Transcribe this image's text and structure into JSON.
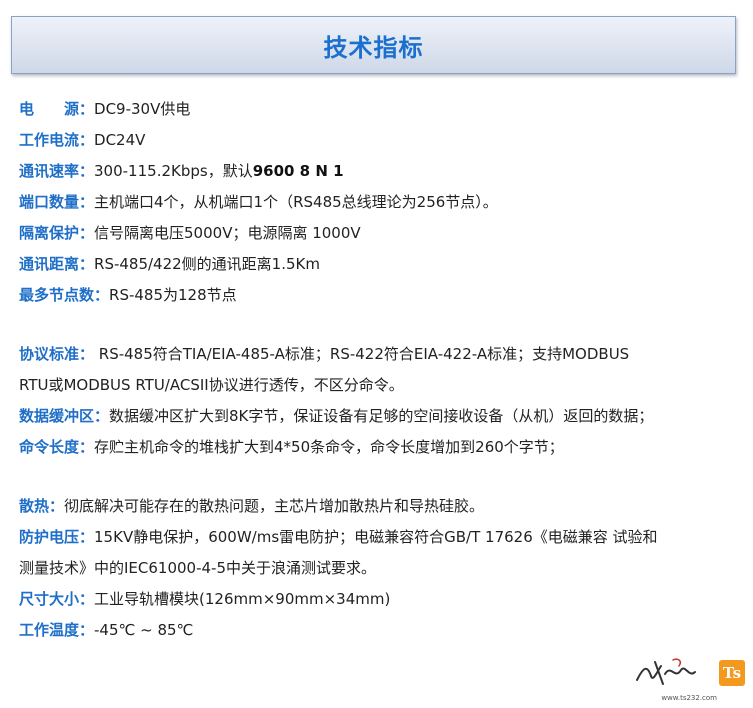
{
  "title": "技术指标",
  "specs": [
    {
      "label": "电　　源：",
      "value": "DC9-30V供电"
    },
    {
      "label": "工作电流：",
      "value": "DC24V"
    },
    {
      "label": "通讯速率：",
      "value": "300-115.2Kbps，默认",
      "strong": "9600 8 N 1"
    },
    {
      "label": "端口数量：",
      "value": "主机端口4个，从机端口1个（RS485总线理论为256节点）。"
    },
    {
      "label": "隔离保护：",
      "value": "信号隔离电压5000V；电源隔离  1000V"
    },
    {
      "label": "通讯距离：",
      "value": "RS-485/422侧的通讯距离1.5Km"
    },
    {
      "label": "最多节点数：",
      "value": "RS-485为128节点"
    },
    {
      "label": "协议标准：",
      "value": " RS-485符合TIA/EIA-485-A标准；RS-422符合EIA-422-A标准；支持MODBUS",
      "cont": "RTU或MODBUS RTU/ACSII协议进行透传，不区分命令。"
    },
    {
      "label": "数据缓冲区：",
      "value": "数据缓冲区扩大到8K字节，保证设备有足够的空间接收设备（从机）返回的数据；"
    },
    {
      "label": "命令长度：",
      "value": "存贮主机命令的堆栈扩大到4*50条命令，命令长度增加到260个字节；"
    },
    {
      "label": "散热：",
      "value": "彻底解决可能存在的散热问题，主芯片增加散热片和导热硅胶。"
    },
    {
      "label": "防护电压：",
      "value": "15KV静电保护，600W/ms雷电防护；电磁兼容符合GB/T 17626《电磁兼容 试验和",
      "cont": "测量技术》中的IEC61000-4-5中关于浪涌测试要求。"
    },
    {
      "label": "尺寸大小：",
      "value": "工业导轨槽模块(126mm×90mm×34mm)"
    },
    {
      "label": "工作温度：",
      "value": "-45℃ ~ 85℃"
    }
  ],
  "watermark": {
    "url": "www.ts232.com",
    "badge": "Ts",
    "badge_color": "#f39a1e"
  },
  "colors": {
    "label": "#1f6fc8",
    "title": "#1a6fcf"
  }
}
